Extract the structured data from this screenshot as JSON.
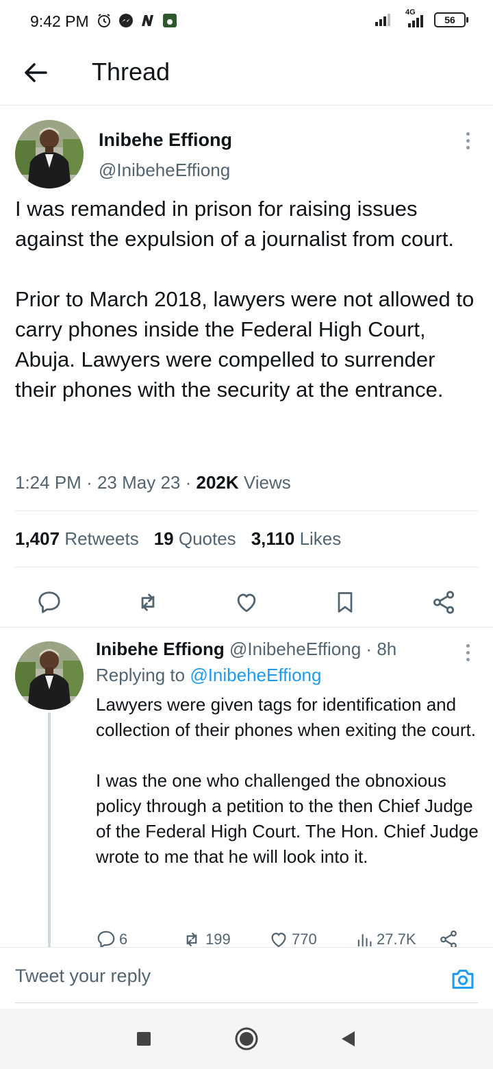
{
  "status_bar": {
    "time": "9:42 PM",
    "network": "4G",
    "battery": "56"
  },
  "header": {
    "title": "Thread"
  },
  "main_tweet": {
    "author_name": "Inibehe Effiong",
    "author_handle": "@InibeheEffiong",
    "text": "I was remanded in prison for raising issues against the expulsion of a journalist from court.\n\nPrior to March 2018, lawyers were not allowed to carry phones inside the Federal High Court, Abuja. Lawyers were compelled to surrender their phones with the security at the entrance.",
    "time": "1:24 PM",
    "date": "23 May 23",
    "views_count": "202K",
    "views_label": "Views",
    "retweets_count": "1,407",
    "retweets_label": "Retweets",
    "quotes_count": "19",
    "quotes_label": "Quotes",
    "likes_count": "3,110",
    "likes_label": "Likes"
  },
  "reply": {
    "author_name": "Inibehe Effiong",
    "author_handle": "@InibeheEffiong",
    "age": "8h",
    "replying_to_label": "Replying to",
    "replying_to_handle": "@InibeheEffiong",
    "text": "Lawyers were given tags for identification and collection of their phones when exiting the court.\n\nI was the one who challenged the obnoxious policy through a petition to the then Chief Judge of the Federal High Court. The Hon. Chief Judge wrote to me that he will look into it.",
    "replies": "6",
    "retweets": "199",
    "likes": "770",
    "views": "27.7K"
  },
  "composer": {
    "placeholder": "Tweet your reply"
  },
  "colors": {
    "accent": "#1d9bf0",
    "text_primary": "#0f1419",
    "text_secondary": "#536471",
    "divider": "#e6e9eb"
  }
}
